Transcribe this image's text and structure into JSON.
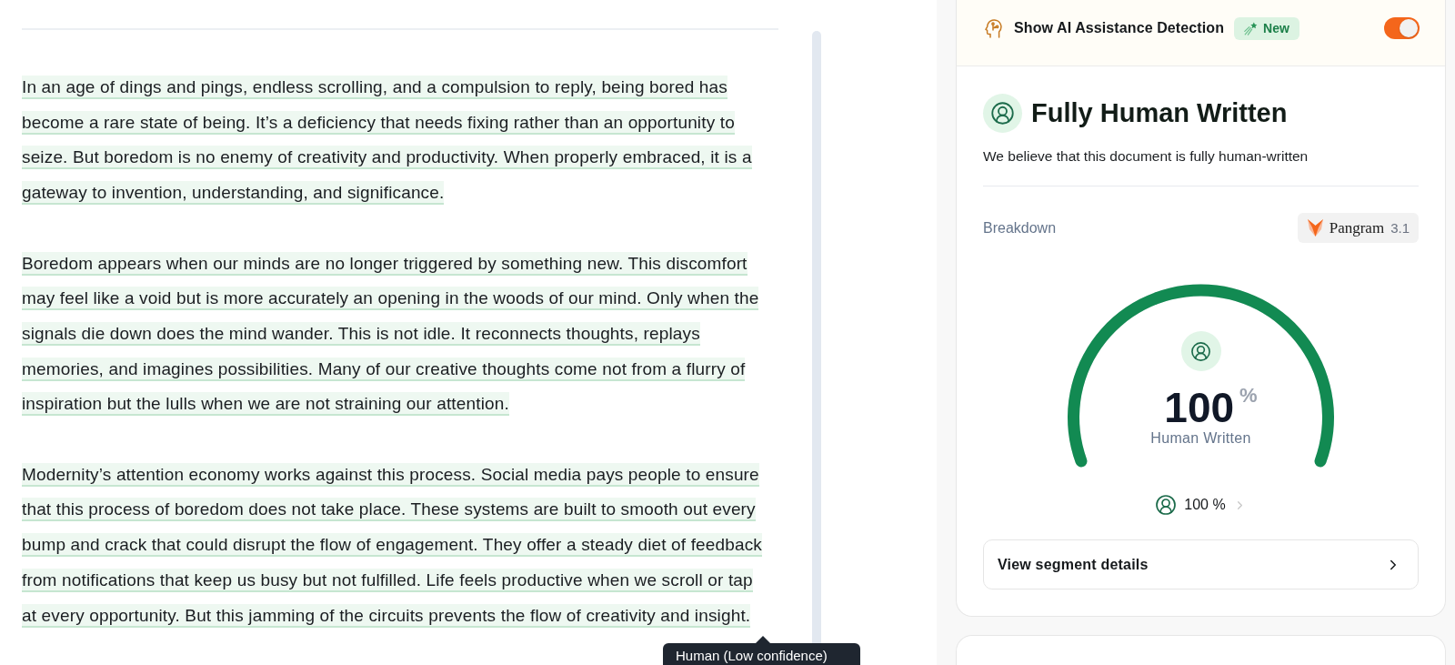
{
  "editor": {
    "paragraphs": [
      {
        "highlighted": true,
        "lines": [
          "In an age of dings and pings, endless scrolling, and a compulsion to reply, being bored has",
          "become a rare state of being. It’s a deficiency that needs fixing rather than an opportunity to",
          "seize. But boredom is no enemy of creativity and productivity. When properly embraced, it is a",
          "gateway to invention, understanding, and significance."
        ]
      },
      {
        "highlighted": true,
        "lines": [
          "Boredom appears when our minds are no longer triggered by something new. This discomfort",
          "may feel like a void but is more accurately an opening in the woods of our mind. Only when the",
          "signals die down does the mind wander. This is not idle. It reconnects thoughts, replays",
          "memories, and imagines possibilities. Many of our creative thoughts come not from a flurry of",
          "inspiration but the lulls when we are not straining our attention."
        ]
      },
      {
        "highlighted": true,
        "lines": [
          "Modernity’s attention economy works against this process. Social media pays people to ensure",
          "that this process of boredom does not take place. These systems are built to smooth out every",
          "bump and crack that could disrupt the flow of engagement. They offer a steady diet of feedback",
          "from notifications that keep us busy but not fulfilled. Life feels productive when we scroll or tap",
          "at every opportunity. But this jamming of the circuits prevents the flow of creativity and insight."
        ]
      }
    ],
    "tooltip": "Human (Low confidence)"
  },
  "panel": {
    "detection": {
      "label": "Show AI Assistance Detection",
      "badge": "New",
      "on": true
    },
    "result": {
      "title": "Fully Human Written",
      "description": "We believe that this document is fully human-written"
    },
    "breakdown": {
      "label": "Breakdown",
      "model": "Pangram",
      "version": "3.1"
    },
    "gauge": {
      "level": 1,
      "value": "100",
      "unit": "%",
      "label": "Human Written"
    },
    "summary": {
      "value": "100 %"
    },
    "details_button": "View segment details"
  }
}
